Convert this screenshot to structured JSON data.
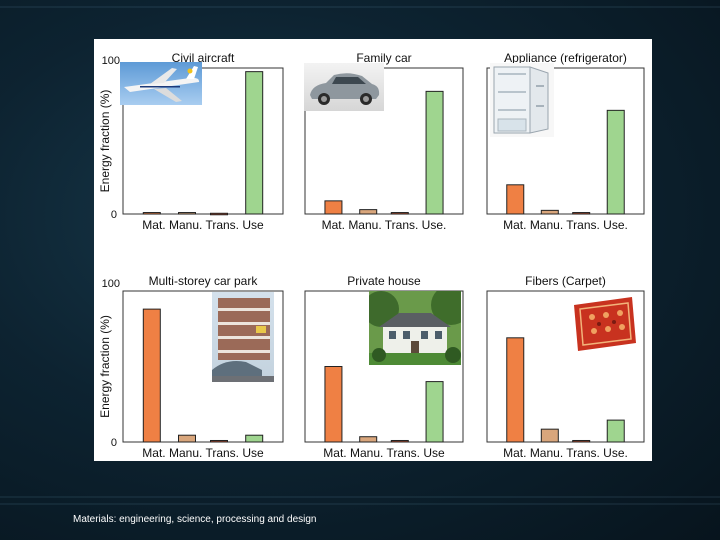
{
  "footer": {
    "caption": "Materials: engineering, science, processing and design"
  },
  "colors": {
    "material": "#ef8044",
    "manufacture": "#d9a67c",
    "transport": "#b44a2c",
    "use": "#9fd58f",
    "edge": "#222222"
  },
  "chart_data": [
    {
      "type": "bar",
      "title": "Civil aircraft",
      "categories": [
        "Mat.",
        "Manu.",
        "Trans.",
        "Use"
      ],
      "values": [
        1,
        1,
        0.5,
        97.5
      ],
      "ylim": [
        0,
        100
      ],
      "ylabel": "Energy fraction (%)",
      "yticks": [
        "0",
        "100"
      ],
      "category_label": "Mat. Manu. Trans. Use",
      "image": "airplane"
    },
    {
      "type": "bar",
      "title": "Family car",
      "categories": [
        "Mat.",
        "Manu.",
        "Trans.",
        "Use."
      ],
      "values": [
        9,
        3,
        1,
        84
      ],
      "ylim": [
        0,
        100
      ],
      "category_label": "Mat. Manu. Trans. Use.",
      "image": "car"
    },
    {
      "type": "bar",
      "title": "Appliance (refrigerator)",
      "categories": [
        "Mat.",
        "Manu.",
        "Trans.",
        "Use."
      ],
      "values": [
        20,
        2.5,
        1,
        71
      ],
      "ylim": [
        0,
        100
      ],
      "category_label": "Mat. Manu. Trans. Use.",
      "image": "refrigerator"
    },
    {
      "type": "bar",
      "title": "Multi-storey car park",
      "categories": [
        "Mat.",
        "Manu.",
        "Trans.",
        "Use"
      ],
      "values": [
        88,
        4.5,
        1,
        4.5
      ],
      "ylim": [
        0,
        100
      ],
      "ylabel": "Energy fraction (%)",
      "yticks": [
        "0",
        "100"
      ],
      "category_label": "Mat. Manu. Trans. Use",
      "image": "car-park"
    },
    {
      "type": "bar",
      "title": "Private house",
      "categories": [
        "Mat.",
        "Manu.",
        "Trans.",
        "Use"
      ],
      "values": [
        50,
        3.5,
        1,
        40
      ],
      "ylim": [
        0,
        100
      ],
      "category_label": "Mat. Manu. Trans. Use",
      "image": "house"
    },
    {
      "type": "bar",
      "title": "Fibers (Carpet)",
      "categories": [
        "Mat.",
        "Manu.",
        "Trans.",
        "Use."
      ],
      "values": [
        69,
        8.5,
        1,
        14.5
      ],
      "ylim": [
        0,
        100
      ],
      "category_label": "Mat. Manu. Trans. Use.",
      "image": "carpet"
    }
  ]
}
